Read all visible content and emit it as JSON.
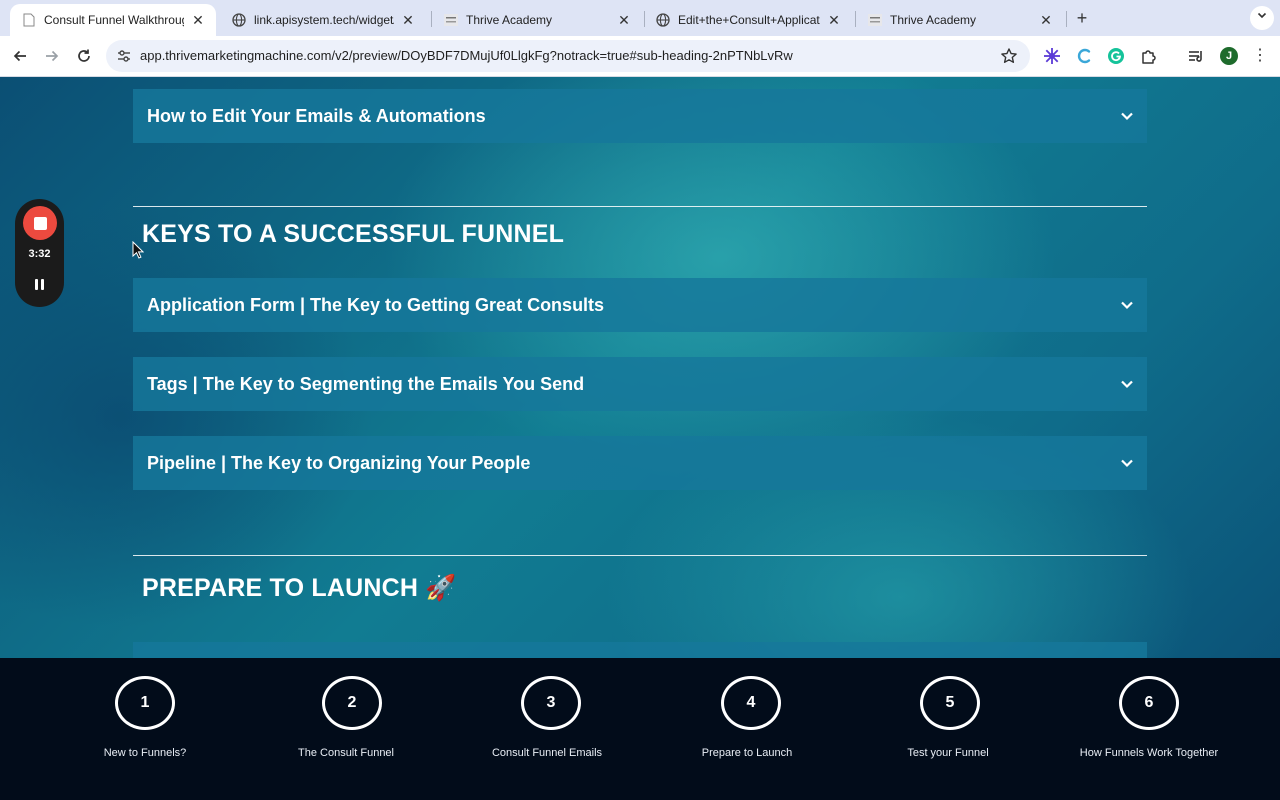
{
  "browser": {
    "tabs": [
      {
        "title": "Consult Funnel Walkthrough",
        "icon": "blank-page-icon",
        "active": true
      },
      {
        "title": "link.apisystem.tech/widget/fo",
        "icon": "globe-icon",
        "active": false
      },
      {
        "title": "Thrive Academy",
        "icon": "thrive-logo-icon",
        "active": false
      },
      {
        "title": "Edit+the+Consult+Applicatio",
        "icon": "globe-icon",
        "active": false
      },
      {
        "title": "Thrive Academy",
        "icon": "thrive-logo-icon",
        "active": false
      }
    ],
    "new_tab": "+",
    "url": "app.thrivemarketingmachine.com/v2/preview/DOyBDF7DMujUf0LlgkFg?notrack=true#sub-heading-2nPTNbLvRw",
    "profile_initial": "J"
  },
  "recorder": {
    "time": "3:32"
  },
  "page": {
    "accordions_top": [
      {
        "label": "How to Edit Your Emails & Automations"
      }
    ],
    "section_keys": {
      "heading": "KEYS TO A SUCCESSFUL FUNNEL",
      "accordions": [
        {
          "label": "Application Form | The Key to Getting Great Consults"
        },
        {
          "label": "Tags | The Key to Segmenting the Emails You Send"
        },
        {
          "label": "Pipeline | The Key to Organizing Your People"
        }
      ]
    },
    "section_launch": {
      "heading": "PREPARE TO LAUNCH 🚀"
    }
  },
  "steps": [
    {
      "number": "1",
      "label": "New to Funnels?"
    },
    {
      "number": "2",
      "label": "The Consult Funnel"
    },
    {
      "number": "3",
      "label": "Consult Funnel Emails"
    },
    {
      "number": "4",
      "label": "Prepare to Launch"
    },
    {
      "number": "5",
      "label": "Test your Funnel"
    },
    {
      "number": "6",
      "label": "How Funnels Work Together"
    }
  ],
  "colors": {
    "accent_red": "#ec4a3f",
    "accordion_bg": "#16789b",
    "steps_bg": "#020c1a"
  }
}
